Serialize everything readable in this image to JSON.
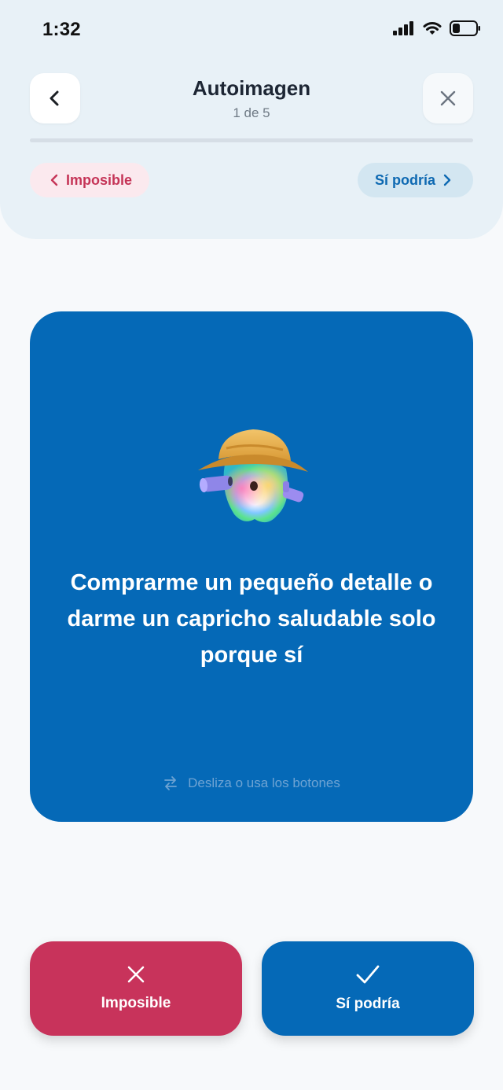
{
  "status_bar": {
    "time": "1:32",
    "icons": [
      "signal-icon",
      "wifi-icon",
      "battery-icon"
    ]
  },
  "header": {
    "title": "Autoimagen",
    "subtitle": "1 de 5",
    "progress": 0.0,
    "hint_left": "Imposible",
    "hint_right": "Sí podría"
  },
  "card": {
    "text": "Comprarme un pequeño detalle o darme un capricho saludable solo porque sí",
    "swipe_hint": "Desliza o usa los botones",
    "mascot": "explorer-mascot-icon"
  },
  "actions": {
    "no_label": "Imposible",
    "yes_label": "Sí podría"
  },
  "colors": {
    "primary": "#0569b7",
    "danger": "#c8335b",
    "header_bg": "#e8f1f7"
  }
}
